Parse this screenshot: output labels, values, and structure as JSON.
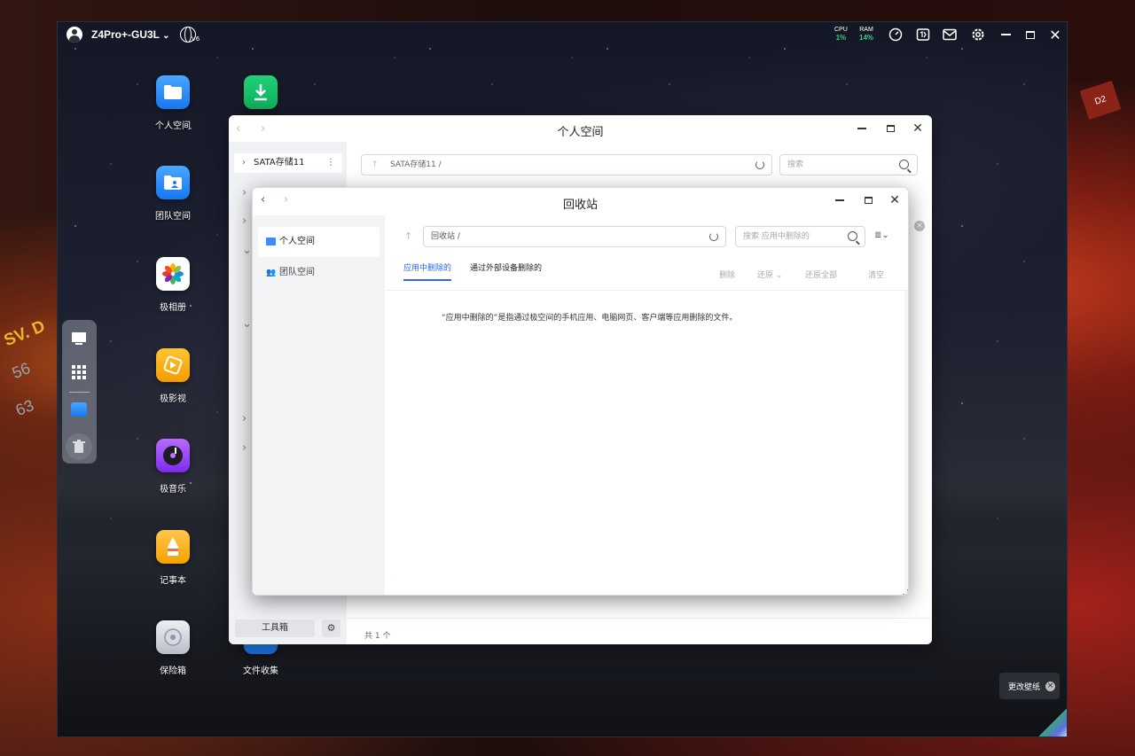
{
  "topbar": {
    "device_name": "Z4Pro+-GU3L",
    "device_chevron": "⌄",
    "ipv6_label": "V6",
    "cpu": {
      "label": "CPU",
      "value": "1%"
    },
    "ram": {
      "label": "RAM",
      "value": "14%"
    },
    "icons": [
      "dashboard-gauge-icon",
      "resource-monitor-icon",
      "mail-icon",
      "gear-icon",
      "minimize-icon",
      "maximize-icon",
      "close-icon"
    ]
  },
  "colors": {
    "accent": "#2b66f6",
    "cpu_green": "#35d07f"
  },
  "desktop_icons": [
    {
      "label": "个人空间",
      "icon": "folder-icon"
    },
    {
      "label": "团队空间",
      "icon": "team-folder-icon"
    },
    {
      "label": "极相册",
      "icon": "photos-flower-icon"
    },
    {
      "label": "极影视",
      "icon": "video-icon"
    },
    {
      "label": "极音乐",
      "icon": "music-disc-icon"
    },
    {
      "label": "记事本",
      "icon": "notepad-icon"
    },
    {
      "label": "保险箱",
      "icon": "safe-icon"
    },
    {
      "label": "文件收集",
      "icon": "file-collect-icon"
    },
    {
      "label": "",
      "icon": "download-icon"
    }
  ],
  "dock": {
    "items": [
      "desktop-icon",
      "apps-grid-icon",
      "folder-icon",
      "trash-icon"
    ]
  },
  "personal_window": {
    "title": "个人空间",
    "sidebar_item": "SATA存储11",
    "sidebar_more": "⋮",
    "path": "SATA存储11 /",
    "search_placeholder": "搜索",
    "toolbox_label": "工具箱",
    "count_text": "共 1 个"
  },
  "trash_window": {
    "title": "回收站",
    "sidebar": [
      {
        "label": "个人空间",
        "icon": "folder-icon"
      },
      {
        "label": "团队空间",
        "icon": "team-icon"
      }
    ],
    "path": "回收站 /",
    "search_placeholder": "搜索 应用中删除的",
    "tabs": [
      {
        "label": "应用中删除的",
        "active": true
      },
      {
        "label": "通过外部设备删除的",
        "active": false
      }
    ],
    "actions": [
      {
        "label": "删除"
      },
      {
        "label": "还原 ⌄"
      },
      {
        "label": "还原全部"
      },
      {
        "label": "清空"
      }
    ],
    "description": "“应用中删除的”是指通过极空间的手机应用、电脑网页、客户端等应用删除的文件。"
  },
  "wallpaper_tip": {
    "label": "更改壁纸",
    "close": "×"
  }
}
